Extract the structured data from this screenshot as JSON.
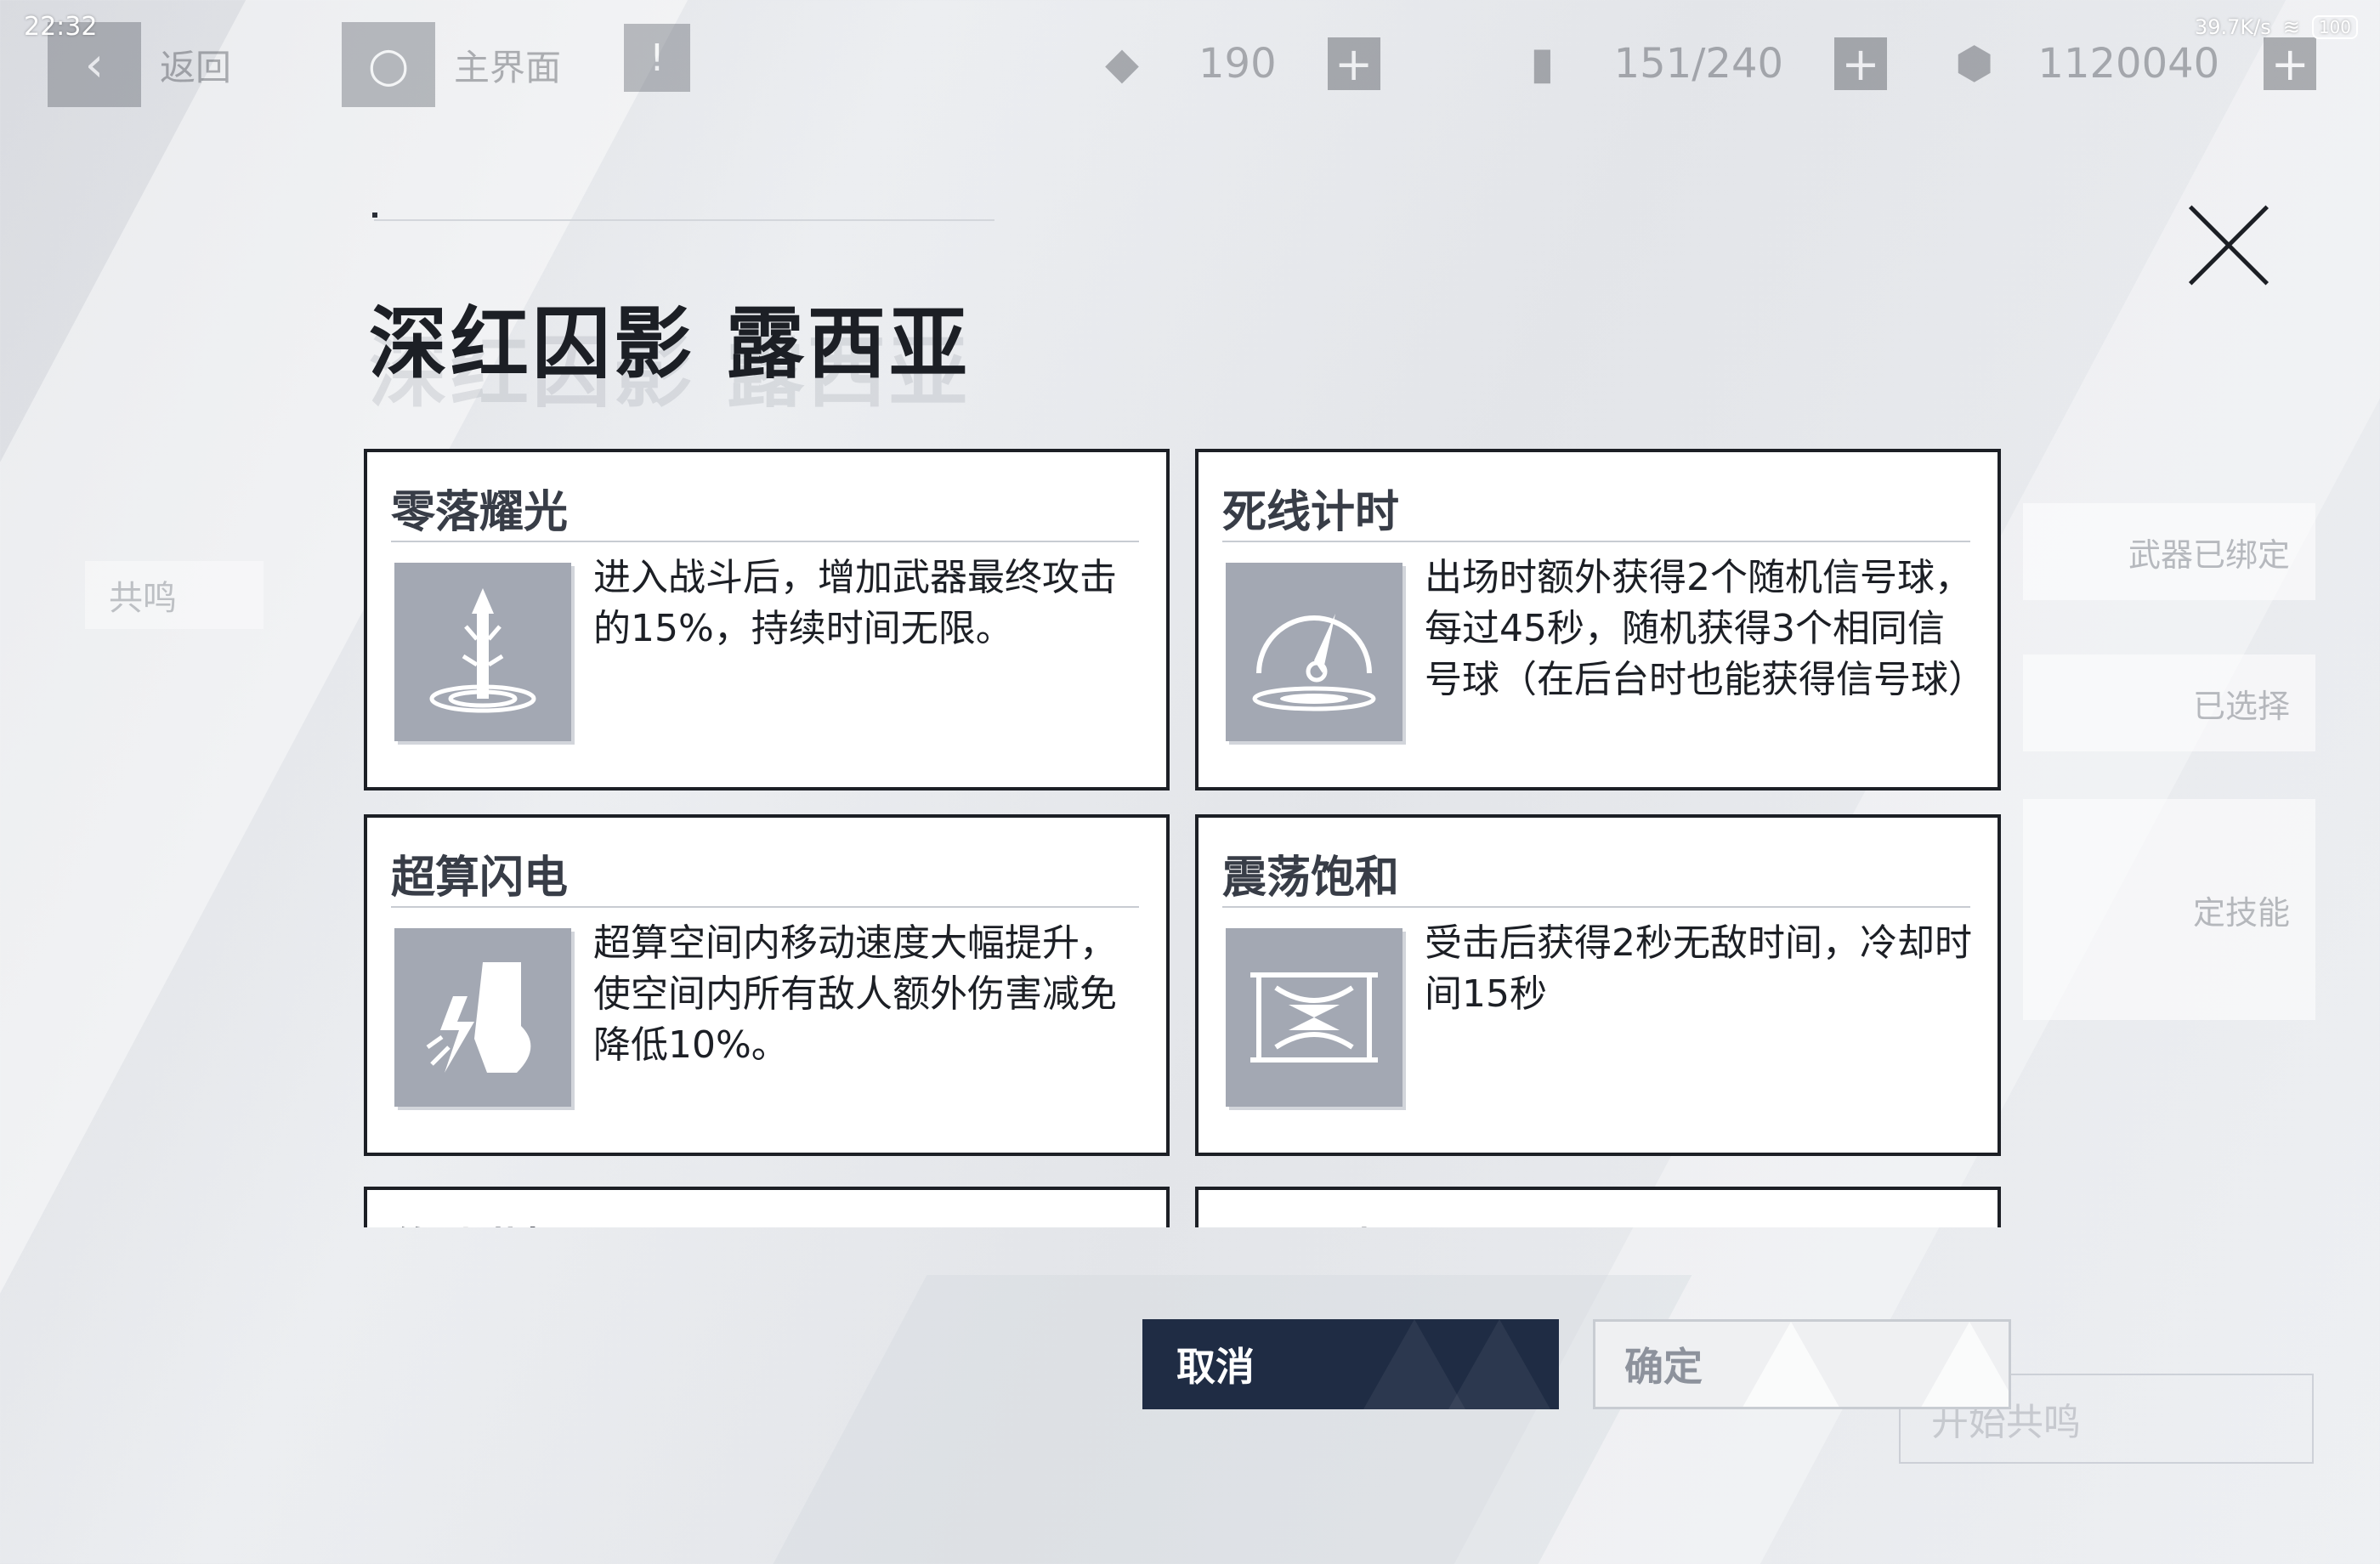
{
  "status_bar": {
    "time": "22:32",
    "net_speed": "39.7K/s",
    "battery": "100"
  },
  "topbar": {
    "back_label": "返回",
    "home_label": "主界面",
    "resources": [
      {
        "icon": "crystal-icon",
        "value": "190"
      },
      {
        "icon": "battery-icon",
        "value": "151/240"
      },
      {
        "icon": "coin-icon",
        "value": "1120040"
      }
    ]
  },
  "background": {
    "left_tab": "共鸣",
    "side_items": [
      "武器已绑定",
      "已选择",
      "定技能"
    ],
    "start_button": "开始共鸣"
  },
  "dialog": {
    "title": "深红囚影 露西亚",
    "cards": [
      {
        "title": "零落耀光",
        "icon": "sword-glow-icon",
        "desc": "进入战斗后，增加武器最终攻击的15%，持续时间无限。"
      },
      {
        "title": "死线计时",
        "icon": "timer-needle-icon",
        "desc": "出场时额外获得2个随机信号球，每过45秒，随机获得3个相同信号球（在后台时也能获得信号球）"
      },
      {
        "title": "超算闪电",
        "icon": "lightning-boot-icon",
        "desc": "超算空间内移动速度大幅提升，使空间内所有敌人额外伤害减免降低10%。"
      },
      {
        "title": "震荡饱和",
        "icon": "hourglass-icon",
        "desc": "受击后获得2秒无敌时间，冷却时间15秒"
      },
      {
        "title": "传动谐振",
        "icon": "",
        "desc": ""
      },
      {
        "title": "雷霆开场",
        "icon": "",
        "desc": ""
      }
    ],
    "cancel_label": "取消",
    "confirm_label": "确定"
  },
  "colors": {
    "dark_button": "#1f2c44",
    "card_border": "#1c1f25",
    "icon_bg": "#a3a8b3"
  }
}
